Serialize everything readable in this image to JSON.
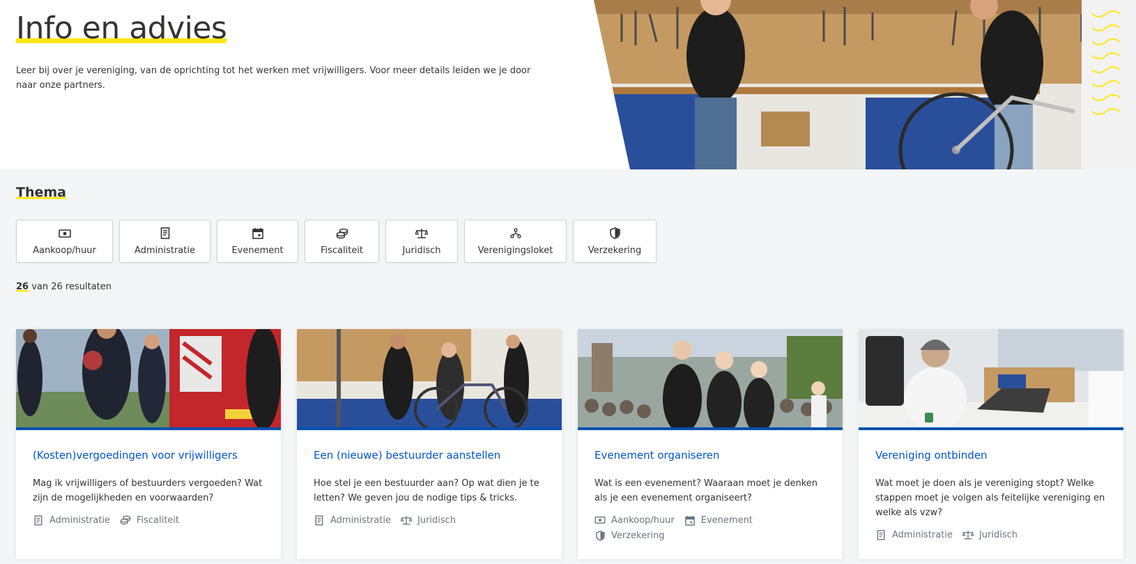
{
  "hero": {
    "title": "Info en advies",
    "intro": "Leer bij over je vereniging, van de oprichting tot het werken met vrijwilligers. Voor meer details leiden we je door naar onze partners."
  },
  "thema": {
    "title": "Thema",
    "filters": [
      {
        "label": "Aankoop/huur",
        "icon": "money-icon"
      },
      {
        "label": "Administratie",
        "icon": "document-icon"
      },
      {
        "label": "Evenement",
        "icon": "calendar-icon"
      },
      {
        "label": "Fiscaliteit",
        "icon": "coins-icon"
      },
      {
        "label": "Juridisch",
        "icon": "scale-icon"
      },
      {
        "label": "Verenigingsloket",
        "icon": "network-icon"
      },
      {
        "label": "Verzekering",
        "icon": "shield-icon"
      }
    ]
  },
  "results": {
    "count": "26",
    "text": " van 26 resultaten"
  },
  "cards": [
    {
      "title": "(Kosten)vergoedingen voor vrijwilligers",
      "text": "Mag ik vrijwilligers of bestuurders vergoeden? Wat zijn de mogelijkheden en voorwaarden?",
      "tags": [
        "Administratie",
        "Fiscaliteit"
      ]
    },
    {
      "title": "Een (nieuwe) bestuurder aanstellen",
      "text": "Hoe stel je een bestuurder aan? Op wat dien je te letten? We geven jou de nodige tips & tricks.",
      "tags": [
        "Administratie",
        "Juridisch"
      ]
    },
    {
      "title": "Evenement organiseren",
      "text": "Wat is een evenement? Waaraan moet je denken als je een evenement organiseert?",
      "tags": [
        "Aankoop/huur",
        "Evenement",
        "Verzekering"
      ]
    },
    {
      "title": "Vereniging ontbinden",
      "text": "Wat moet je doen als je vereniging stopt? Welke stappen moet je volgen als feitelijke vereniging en welke als vzw?",
      "tags": [
        "Administratie",
        "Juridisch"
      ]
    }
  ],
  "colors": {
    "accent_yellow": "#ffe615",
    "link_blue": "#0055cc",
    "card_border_blue": "#0050b4",
    "page_bg": "#f3f5f6"
  }
}
